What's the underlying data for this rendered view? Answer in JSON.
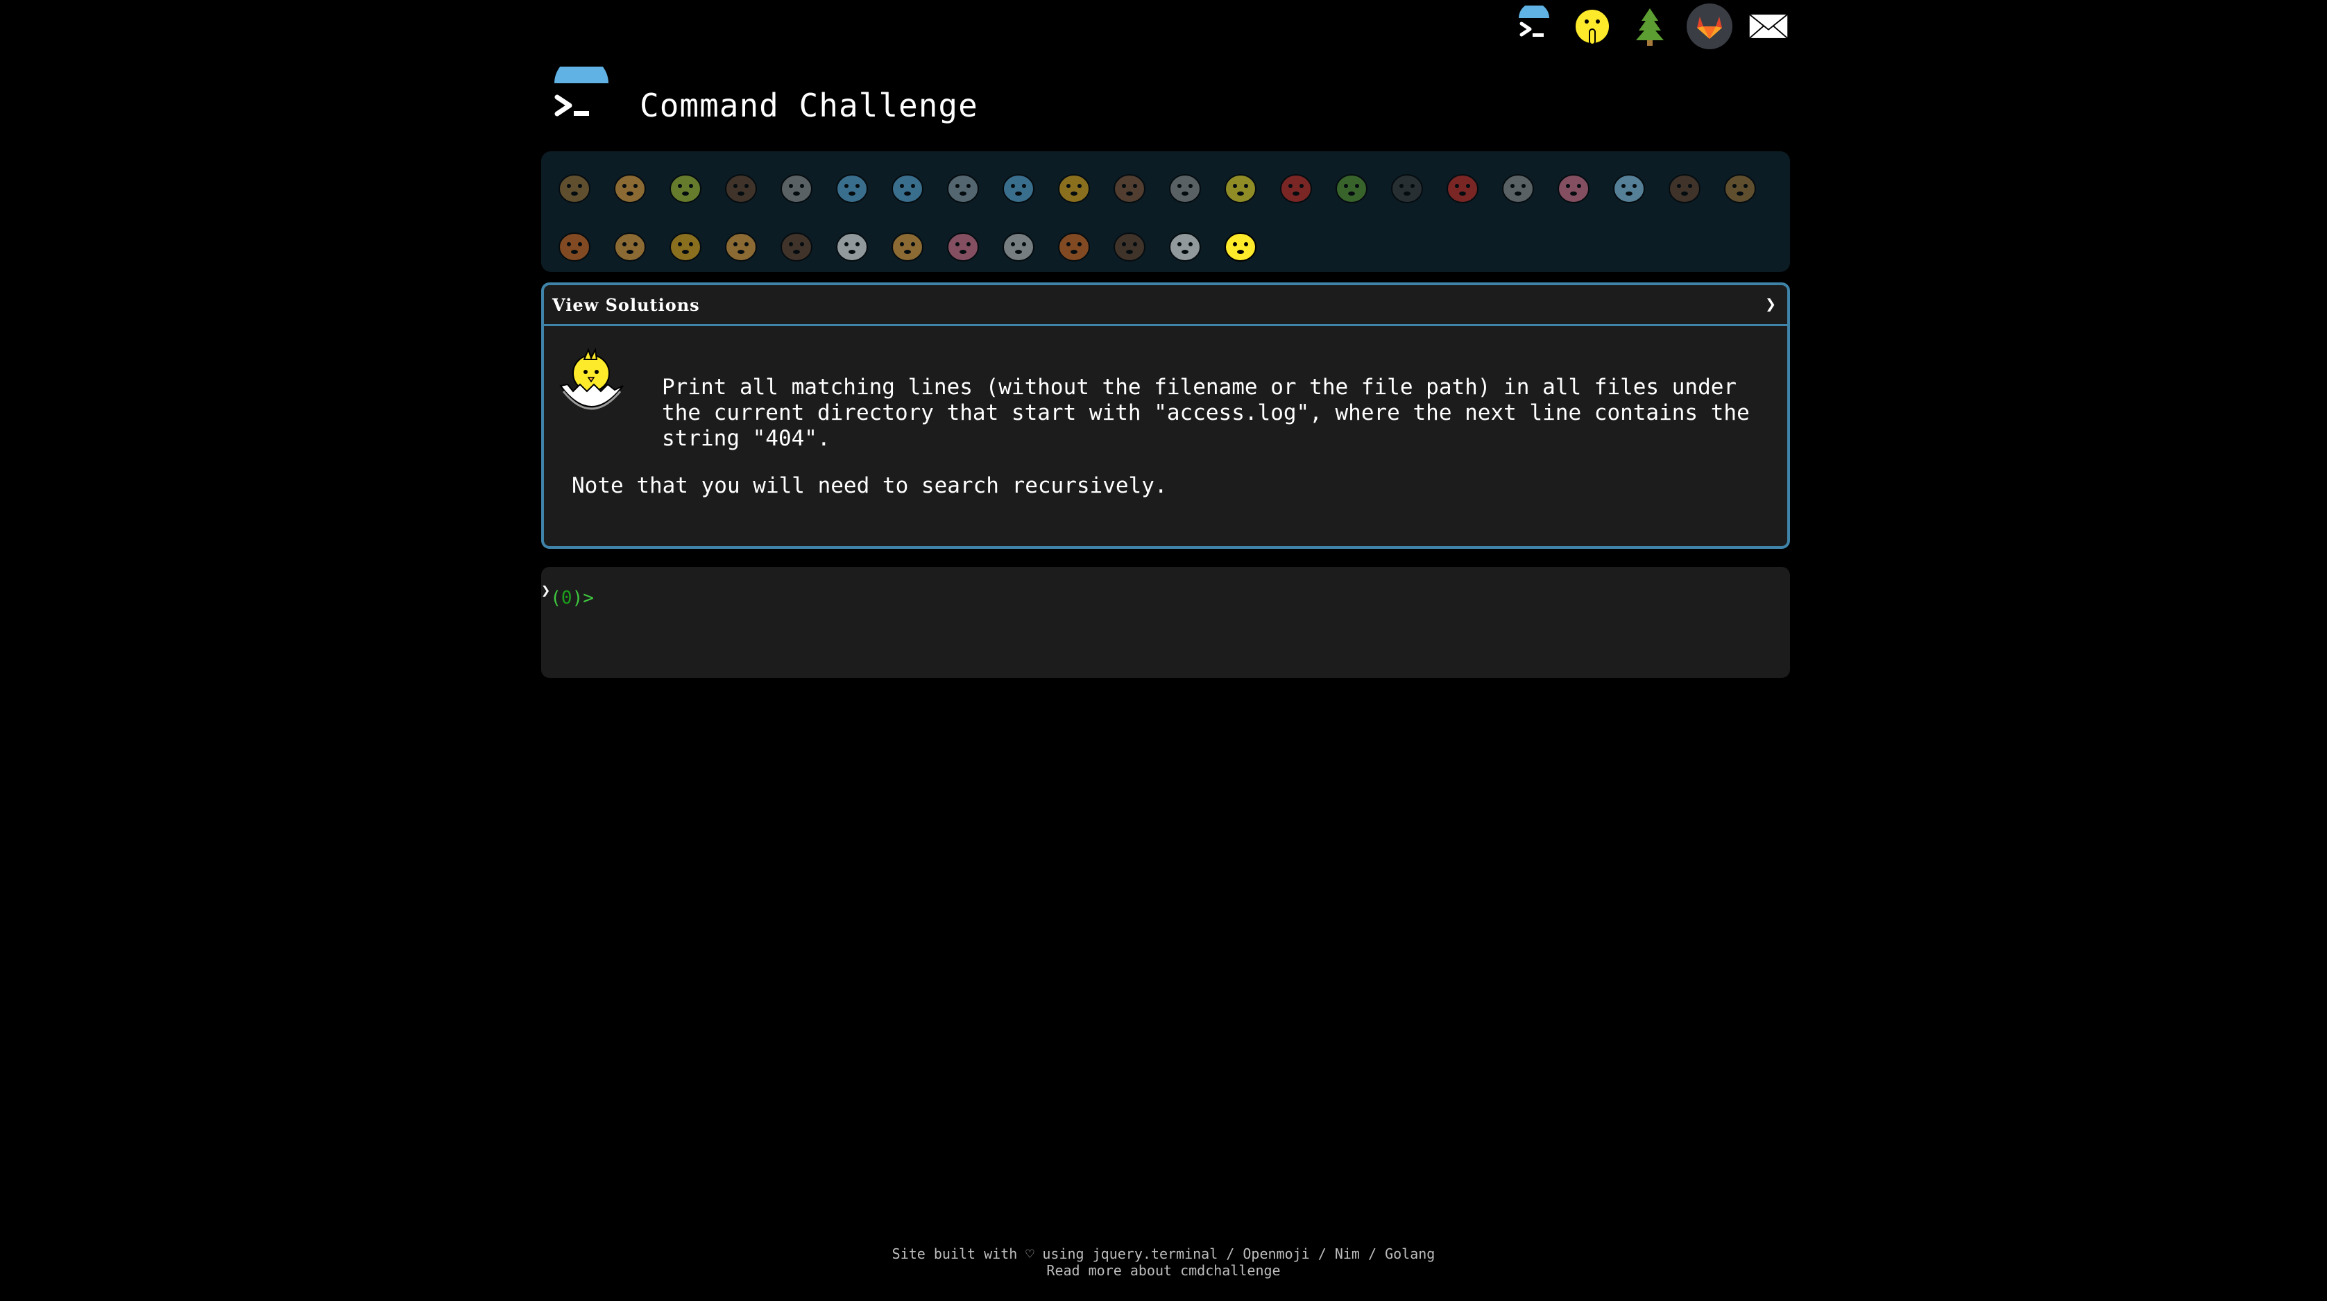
{
  "header": {
    "title": "Command Challenge"
  },
  "top_icons": [
    {
      "name": "terminal-logo-icon"
    },
    {
      "name": "shushing-face-icon"
    },
    {
      "name": "tree-icon"
    },
    {
      "name": "gitlab-icon"
    },
    {
      "name": "mail-icon"
    }
  ],
  "challenges": {
    "row1": [
      "snail",
      "butterfly",
      "caterpillar",
      "ant",
      "spider-web",
      "whale",
      "dolphin",
      "shark",
      "fish",
      "tropical-fish",
      "hedgehog",
      "wolf",
      "bee",
      "ladybug",
      "worm",
      "spider",
      "scorpion",
      "fly",
      "earthworm",
      "microbe",
      "gorilla",
      "dog"
    ],
    "row2": [
      "fox",
      "cat",
      "lion",
      "tiger",
      "horse",
      "unicorn",
      "cow",
      "pig",
      "mouse",
      "hamster",
      "bear",
      "panda",
      "hatching-chick"
    ],
    "current": "hatching-chick"
  },
  "task": {
    "header_label": "View Solutions",
    "chevron": "❯",
    "description": "Print all matching lines (without the filename or the file path) in all files under the current directory that start with \"access.log\", where the next line contains the string \"404\".",
    "note": "Note that you will need to search recursively."
  },
  "terminal": {
    "prompt_mark": "❯",
    "prompt_open": "(",
    "prompt_count": "0",
    "prompt_close": ")>"
  },
  "footer": {
    "line1_prefix": "Site built with ♡ using ",
    "jquery_link": "jquery.terminal",
    "sep1": " / ",
    "openmoji_link": "Openmoji",
    "sep2": " / ",
    "nim_link": "Nim",
    "sep3": " / ",
    "golang_link": "Golang",
    "line2": "Read more about cmdchallenge"
  },
  "colors": {
    "background": "#000000",
    "panel": "#1c1c1c",
    "progress_bar": "#0c1c24",
    "accent_border": "#3f83a8",
    "prompt_green": "#3fc93f"
  }
}
